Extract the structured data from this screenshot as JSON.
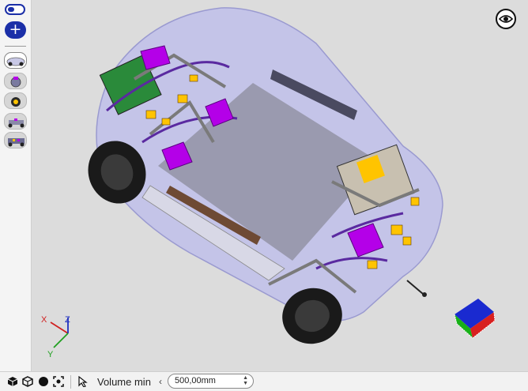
{
  "sidebar": {
    "toggle_state": "on",
    "add_label": "+",
    "variants": [
      {
        "name": "variant-1",
        "active": true
      },
      {
        "name": "variant-2",
        "active": false
      },
      {
        "name": "variant-3",
        "active": false
      },
      {
        "name": "variant-4",
        "active": false
      },
      {
        "name": "variant-5",
        "active": false
      }
    ]
  },
  "viewport": {
    "axes": {
      "x": "X",
      "y": "Y",
      "z": "Z"
    },
    "colors": {
      "body_shell": "#b9b9e8",
      "battery": "#b400e8",
      "components": "#ffc400",
      "wiring": "#5a2aa0",
      "tire": "#1a1a1a",
      "floor": "#8a8a98"
    }
  },
  "statusbar": {
    "tools": [
      "view-cube-icon",
      "solid-sphere-icon",
      "fit-view-icon",
      "select-cursor-icon"
    ],
    "volume_label": "Volume min",
    "volume_value": "500,00mm",
    "decrease_symbol": "‹"
  }
}
